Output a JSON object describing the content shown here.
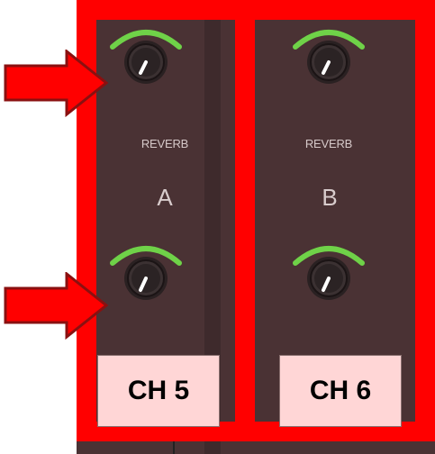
{
  "channels": [
    {
      "reverb_label": "REVERB",
      "bus_label": "A",
      "channel_label": "CH 5"
    },
    {
      "reverb_label": "REVERB",
      "bus_label": "B",
      "channel_label": "CH 6"
    }
  ],
  "colors": {
    "annotation_red": "#ff0000",
    "panel": "#4a3234",
    "ring_green": "#5fbf3a",
    "channel_box": "#ffd6d6"
  },
  "icons": {
    "arrow": "arrow-right-icon",
    "knob": "rotary-knob-icon"
  }
}
